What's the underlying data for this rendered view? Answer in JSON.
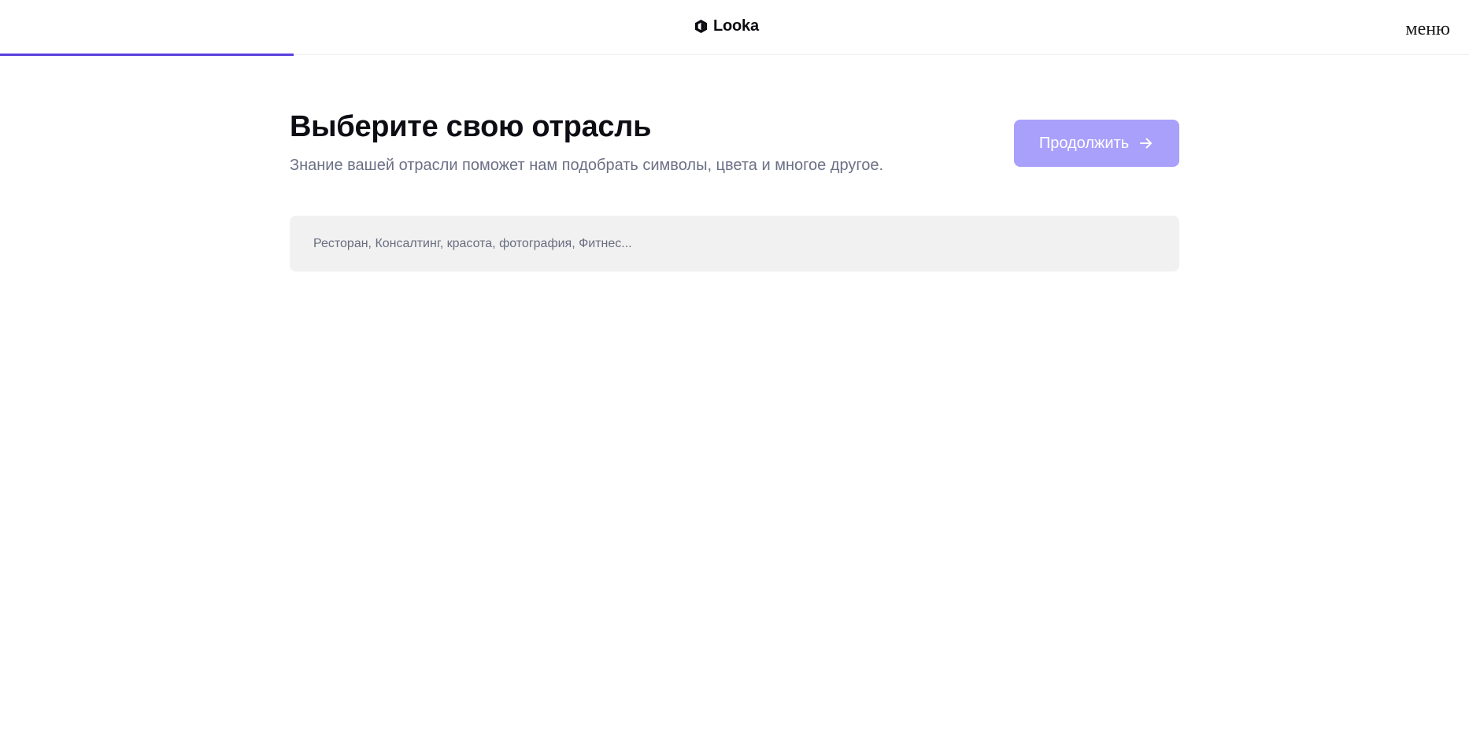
{
  "header": {
    "logo_text": "Looka",
    "menu_label": "меню",
    "progress_percent": 20
  },
  "main": {
    "title": "Выберите свою отрасль",
    "subtitle": "Знание вашей отрасли поможет нам подобрать символы, цвета и многое другое.",
    "continue_label": "Продолжить",
    "search": {
      "placeholder": "Ресторан, Консалтинг, красота, фотография, Фитнес...",
      "value": ""
    }
  },
  "colors": {
    "accent": "#5a3ee0",
    "button_disabled": "#a8a0fb",
    "input_bg": "#f1f1f1"
  },
  "icons": {
    "logo": "looka-logo-icon",
    "continue": "arrow-right-icon"
  }
}
